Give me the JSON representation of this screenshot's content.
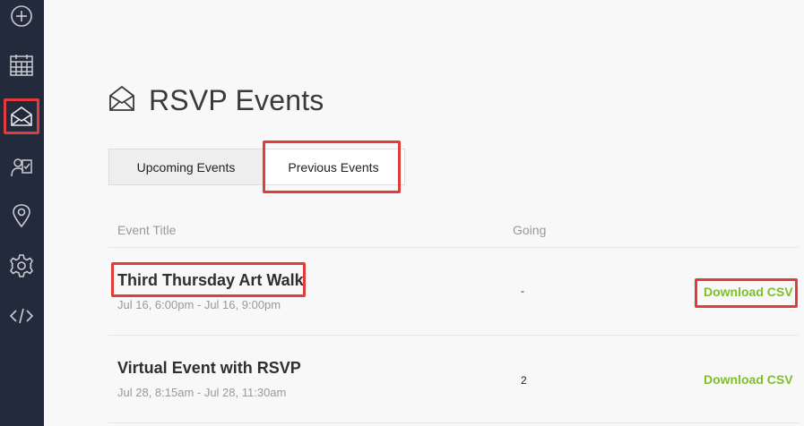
{
  "sidebar": {
    "items": [
      {
        "name": "add-icon"
      },
      {
        "name": "calendar-icon"
      },
      {
        "name": "envelope-icon",
        "active": true
      },
      {
        "name": "clipboard-user-icon"
      },
      {
        "name": "location-pin-icon"
      },
      {
        "name": "gear-icon"
      },
      {
        "name": "code-icon"
      }
    ]
  },
  "header": {
    "icon": "open-envelope-icon",
    "title": "RSVP Events"
  },
  "tabs": [
    {
      "label": "Upcoming Events",
      "selected": false
    },
    {
      "label": "Previous Events",
      "selected": true
    }
  ],
  "table": {
    "columns": [
      "Event Title",
      "Going"
    ],
    "rows": [
      {
        "title": "Third Thursday Art Walk",
        "dates": "Jul 16, 6:00pm - Jul 16, 9:00pm",
        "going": "-",
        "action": "Download CSV"
      },
      {
        "title": "Virtual Event with RSVP",
        "dates": "Jul 28, 8:15am - Jul 28, 11:30am",
        "going": "2",
        "action": "Download CSV"
      }
    ]
  },
  "colors": {
    "sidebar_bg": "#232a3b",
    "highlight": "#e03c3c",
    "link_green": "#7cc02a"
  }
}
